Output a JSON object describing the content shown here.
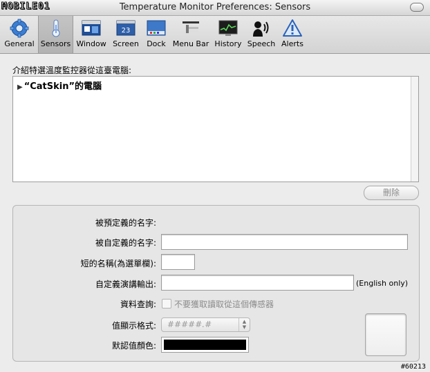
{
  "window": {
    "title": "Temperature Monitor Preferences: Sensors",
    "watermark": "MOBILE01"
  },
  "toolbar": {
    "items": [
      {
        "label": "General",
        "icon": "gear-icon"
      },
      {
        "label": "Sensors",
        "icon": "thermometer-icon",
        "selected": true
      },
      {
        "label": "Window",
        "icon": "window-icon"
      },
      {
        "label": "Screen",
        "icon": "screen-icon",
        "badge": "23"
      },
      {
        "label": "Dock",
        "icon": "dock-icon"
      },
      {
        "label": "Menu Bar",
        "icon": "menubar-icon"
      },
      {
        "label": "History",
        "icon": "history-icon"
      },
      {
        "label": "Speech",
        "icon": "speech-icon"
      },
      {
        "label": "Alerts",
        "icon": "alert-icon"
      }
    ]
  },
  "sensors": {
    "section_label": "介紹特選溫度監控器從這臺電腦:",
    "tree": [
      {
        "label": "“CatSkin”的電腦",
        "expanded": false
      }
    ],
    "delete_label": "刪除"
  },
  "details": {
    "predefined_name_label": "被預定義的名字:",
    "custom_name_label": "被自定義的名字:",
    "custom_name_value": "",
    "short_name_label": "短的名稱(為選單欄):",
    "short_name_value": "",
    "speech_output_label": "自定義演講輸出:",
    "speech_output_value": "",
    "english_only_hint": "(English only)",
    "query_label": "資料查詢:",
    "query_checkbox_label": "不要獲取讀取從這個傳感器",
    "query_checked": false,
    "format_label": "值顯示格式:",
    "format_value": "#####.#",
    "default_color_label": "默認值顏色:",
    "default_color": "#000000"
  },
  "footer": {
    "tag": "#60213"
  },
  "colors": {
    "selected_tab": "#b8b8b8",
    "window_bg": "#ececec"
  }
}
